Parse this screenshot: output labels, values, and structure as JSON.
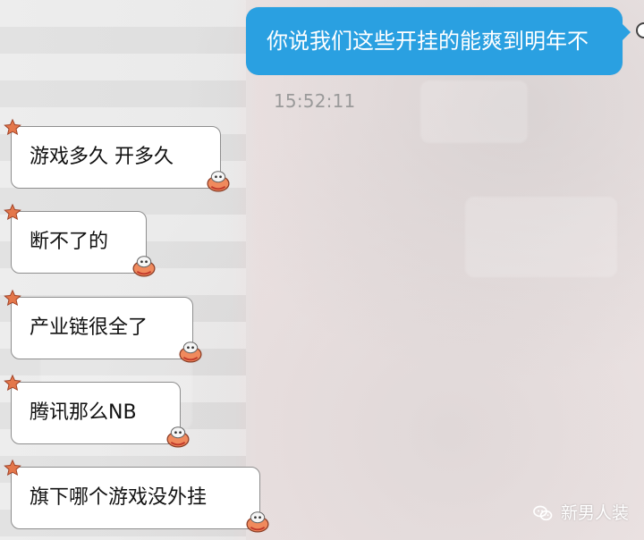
{
  "outgoing": {
    "text": "你说我们这些开挂的能爽到明年不",
    "timestamp": "15:52:11"
  },
  "incoming": [
    {
      "text": "游戏多久 开多久"
    },
    {
      "text": "断不了的"
    },
    {
      "text": "产业链很全了"
    },
    {
      "text": "腾讯那么NB"
    },
    {
      "text": "旗下哪个游戏没外挂"
    }
  ],
  "watermark": {
    "text": "新男人装",
    "icon": "wechat-icon"
  },
  "colors": {
    "outgoing_bubble": "#2aa0e1",
    "incoming_bubble": "#ffffff",
    "timestamp": "#9a9a9a"
  }
}
